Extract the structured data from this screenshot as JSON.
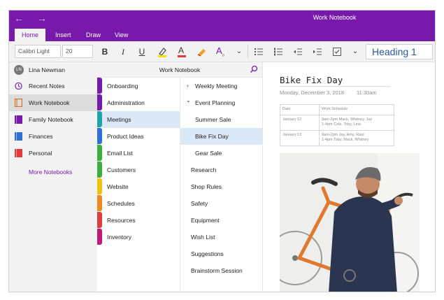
{
  "window": {
    "title": "Work Notebook"
  },
  "ribbon": {
    "tabs": [
      "Home",
      "Insert",
      "Draw",
      "View"
    ],
    "active_tab": "Home"
  },
  "toolbar": {
    "font_name": "Calibri Light",
    "font_size": "20",
    "style": "Heading 1",
    "icons": [
      "bold-icon",
      "italic-icon",
      "underline-icon",
      "highlight-icon",
      "font-color-icon",
      "clear-format-icon",
      "text-styles-icon",
      "chevron-down-icon",
      "bullet-list-icon",
      "numbered-list-icon",
      "outdent-icon",
      "indent-icon",
      "checkbox-icon",
      "chevron-down-icon"
    ],
    "glyphs": {
      "bold": "B",
      "italic": "I",
      "underline": "U",
      "font_color": "A",
      "text_styles": "A",
      "chevron": "⌄"
    }
  },
  "user": {
    "initials": "LN",
    "name": "Lina Newman"
  },
  "notebooks": {
    "items": [
      {
        "label": "Recent Notes",
        "icon": "clock-icon",
        "color": "#7719aa"
      },
      {
        "label": "Work Notebook",
        "icon": "notebook-icon",
        "color": "#d86b1f"
      },
      {
        "label": "Family Notebook",
        "icon": "notebook-icon",
        "color": "#7719aa"
      },
      {
        "label": "Finances",
        "icon": "notebook-icon",
        "color": "#2f6fd6"
      },
      {
        "label": "Personal",
        "icon": "notebook-icon",
        "color": "#e03c3c"
      }
    ],
    "more_label": "More Notebooks",
    "active_index": 1
  },
  "section_header": {
    "title": "Work Notebook"
  },
  "sections": {
    "items": [
      {
        "label": "Onboarding",
        "color": "#7719aa"
      },
      {
        "label": "Administration",
        "color": "#7719aa"
      },
      {
        "label": "Meetings",
        "color": "#1fa5a5"
      },
      {
        "label": "Product Ideas",
        "color": "#2f6fd6"
      },
      {
        "label": "Email List",
        "color": "#3cae3c"
      },
      {
        "label": "Customers",
        "color": "#3cae3c"
      },
      {
        "label": "Website",
        "color": "#f4c20d"
      },
      {
        "label": "Schedules",
        "color": "#f08a1c"
      },
      {
        "label": "Resources",
        "color": "#e03c3c"
      },
      {
        "label": "Inventory",
        "color": "#c2187a"
      }
    ],
    "active_index": 2
  },
  "pages": {
    "items": [
      {
        "label": "Weekly Meeting",
        "chevron": "›",
        "indent": 0
      },
      {
        "label": "Event Planning",
        "chevron": "⌄",
        "indent": 0
      },
      {
        "label": "Summer Sale",
        "chevron": "",
        "indent": 1
      },
      {
        "label": "Bike Fix Day",
        "chevron": "",
        "indent": 1
      },
      {
        "label": "Gear Sale",
        "chevron": "",
        "indent": 1
      },
      {
        "label": "Research",
        "chevron": "",
        "indent": 0
      },
      {
        "label": "Shop Rules",
        "chevron": "",
        "indent": 0
      },
      {
        "label": "Safety",
        "chevron": "",
        "indent": 0
      },
      {
        "label": "Equipment",
        "chevron": "",
        "indent": 0
      },
      {
        "label": "Wish List",
        "chevron": "",
        "indent": 0
      },
      {
        "label": "Suggestions",
        "chevron": "",
        "indent": 0
      },
      {
        "label": "Brainstorm Session",
        "chevron": "",
        "indent": 0
      }
    ],
    "active_index": 3
  },
  "page": {
    "title": "Bike Fix Day",
    "date": "Monday, December 3, 2018",
    "time": "11:30am",
    "table": {
      "headers": [
        "Date",
        "Work Schedule"
      ],
      "rows": [
        [
          "January 12",
          "9am-2pm Mack, Whitney, Jay\n1-4pm Cole, Toby, Lina"
        ],
        [
          "January 13",
          "9am-2pm Jay, Amy, Raul\n1-4pm Toby, Mack, Whitney"
        ]
      ]
    }
  },
  "colors": {
    "accent": "#7719aa",
    "selection": "#dbe9f7",
    "heading_style": "#2b5797"
  }
}
